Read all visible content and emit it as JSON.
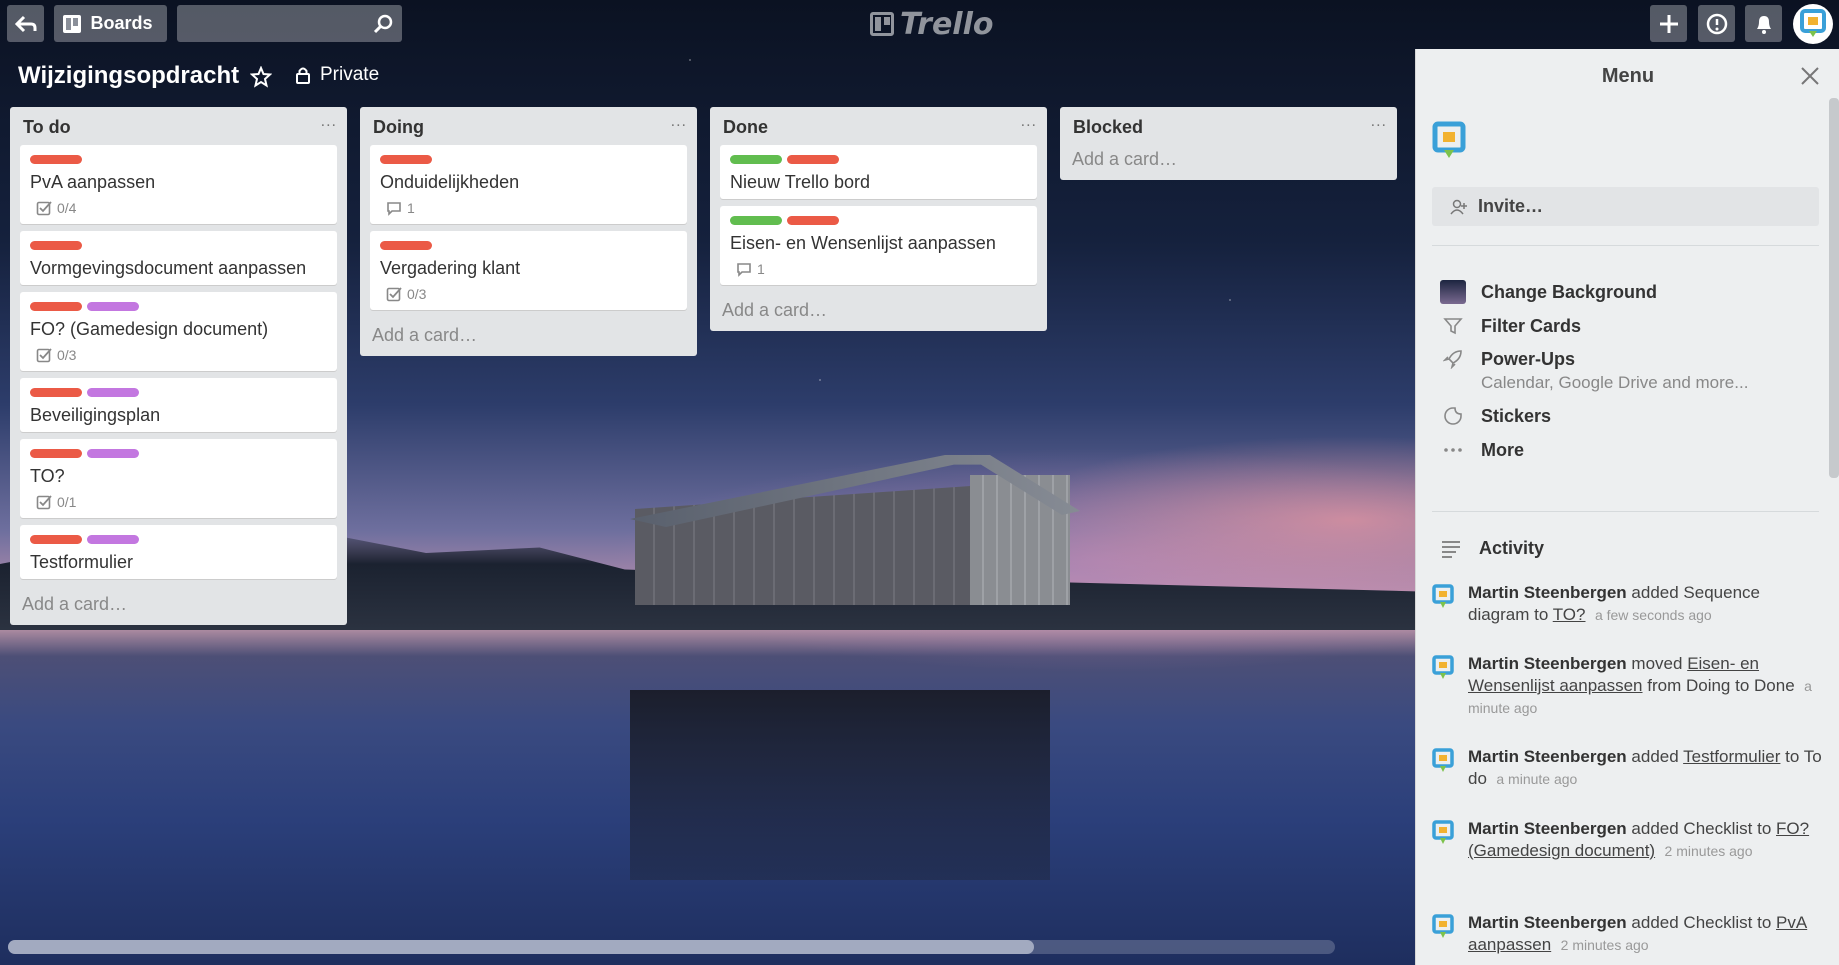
{
  "header": {
    "boards_label": "Boards",
    "search_placeholder": "",
    "logo_text": "Trello"
  },
  "board": {
    "title": "Wijzigingsopdracht",
    "visibility": "Private"
  },
  "colors": {
    "label_red": "#eb5a46",
    "label_purple": "#c377e0",
    "label_green": "#61bd4f"
  },
  "lists": [
    {
      "title": "To do",
      "menu": "...",
      "add_card": "Add a card…",
      "cards": [
        {
          "title": "PvA aanpassen",
          "labels": [
            "red"
          ],
          "badge": "0/4",
          "badge_type": "checklist"
        },
        {
          "title": "Vormgevingsdocument aanpassen",
          "labels": [
            "red"
          ]
        },
        {
          "title": "FO? (Gamedesign document)",
          "labels": [
            "red",
            "purple"
          ],
          "badge": "0/3",
          "badge_type": "checklist"
        },
        {
          "title": "Beveiligingsplan",
          "labels": [
            "red",
            "purple"
          ]
        },
        {
          "title": "TO?",
          "labels": [
            "red",
            "purple"
          ],
          "badge": "0/1",
          "badge_type": "checklist"
        },
        {
          "title": "Testformulier",
          "labels": [
            "red",
            "purple"
          ]
        }
      ]
    },
    {
      "title": "Doing",
      "menu": "...",
      "add_card": "Add a card…",
      "cards": [
        {
          "title": "Onduidelijkheden",
          "labels": [
            "red"
          ],
          "badge": "1",
          "badge_type": "comment"
        },
        {
          "title": "Vergadering klant",
          "labels": [
            "red"
          ],
          "badge": "0/3",
          "badge_type": "checklist"
        }
      ]
    },
    {
      "title": "Done",
      "menu": "...",
      "add_card": "Add a card…",
      "cards": [
        {
          "title": "Nieuw Trello bord",
          "labels": [
            "green",
            "red"
          ]
        },
        {
          "title": "Eisen- en Wensenlijst aanpassen",
          "labels": [
            "green",
            "red"
          ],
          "badge": "1",
          "badge_type": "comment"
        }
      ]
    },
    {
      "title": "Blocked",
      "menu": "...",
      "add_card": "Add a card…",
      "cards": []
    }
  ],
  "menu": {
    "title": "Menu",
    "invite": "Invite…",
    "items": {
      "change_background": "Change Background",
      "filter_cards": "Filter Cards",
      "power_ups": "Power-Ups",
      "power_ups_sub": "Calendar, Google Drive and more...",
      "stickers": "Stickers",
      "more": "More"
    },
    "activity_title": "Activity",
    "activity": [
      {
        "user": "Martin Steenbergen",
        "pre": " added Sequence diagram to ",
        "link": "TO?",
        "post": "",
        "time": "a few seconds ago"
      },
      {
        "user": "Martin Steenbergen",
        "pre": " moved ",
        "link": "Eisen- en Wensenlijst aanpassen",
        "post": " from Doing to Done",
        "time": "a minute ago"
      },
      {
        "user": "Martin Steenbergen",
        "pre": " added ",
        "link": "Testformulier",
        "post": " to To do",
        "time": "a minute ago"
      },
      {
        "user": "Martin Steenbergen",
        "pre": " added Checklist to ",
        "link": "FO? (Gamedesign document)",
        "post": "",
        "time": "2 minutes ago"
      },
      {
        "user": "Martin Steenbergen",
        "pre": " added Checklist to ",
        "link": "PvA aanpassen",
        "post": "",
        "time": "2 minutes ago"
      }
    ]
  }
}
